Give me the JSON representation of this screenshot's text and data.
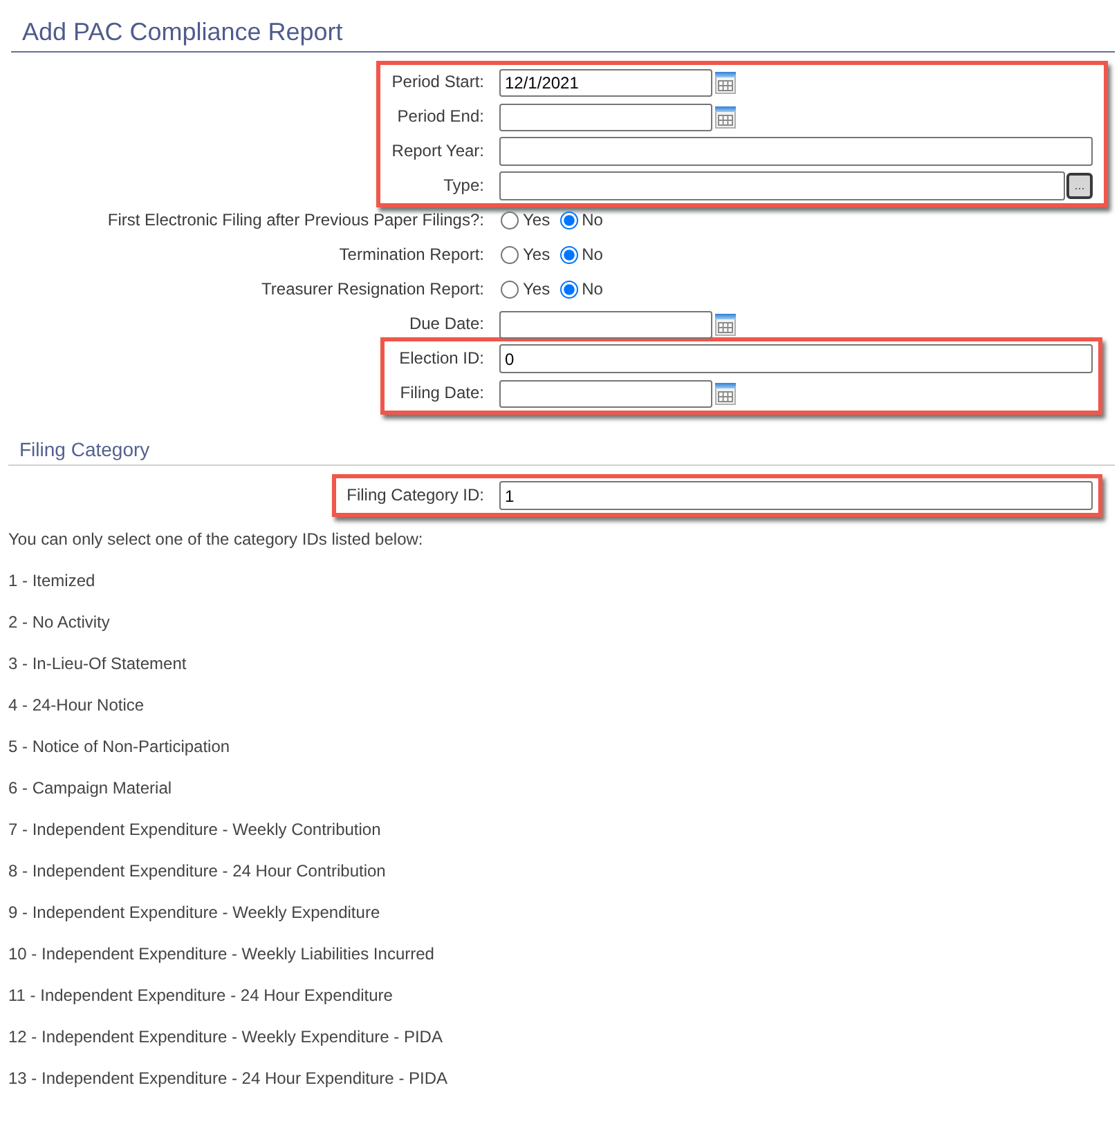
{
  "title": "Add PAC Compliance Report",
  "report_form": [
    {
      "highlighted": true,
      "rows": [
        {
          "kind": "date",
          "label": "Period Start:",
          "value": "12/1/2021"
        },
        {
          "kind": "date",
          "label": "Period End:"
        },
        {
          "kind": "text",
          "label": "Report Year:"
        },
        {
          "kind": "lookup",
          "label": "Type:",
          "button": "..."
        }
      ]
    },
    {
      "highlighted": false,
      "rows": [
        {
          "kind": "radio",
          "label": "First Electronic Filing after Previous Paper Filings?:",
          "options": [
            {
              "label": "Yes",
              "selected": false
            },
            {
              "label": "No",
              "selected": true
            }
          ]
        },
        {
          "kind": "radio",
          "label": "Termination Report:",
          "options": [
            {
              "label": "Yes",
              "selected": false
            },
            {
              "label": "No",
              "selected": true
            }
          ]
        },
        {
          "kind": "radio",
          "label": "Treasurer Resignation Report:",
          "options": [
            {
              "label": "Yes",
              "selected": false
            },
            {
              "label": "No",
              "selected": true
            }
          ]
        },
        {
          "kind": "date",
          "label": "Due Date:"
        }
      ]
    },
    {
      "highlighted": true,
      "rows": [
        {
          "kind": "text",
          "label": "Election ID:",
          "value": "0"
        },
        {
          "kind": "date",
          "label": "Filing Date:"
        }
      ]
    }
  ],
  "filing_category": {
    "heading": "Filing Category",
    "form": [
      {
        "highlighted": true,
        "rows": [
          {
            "kind": "text",
            "label": "Filing Category ID:",
            "value": "1"
          }
        ]
      }
    ],
    "instruction": "You can only select one of the category IDs listed below:",
    "categories": [
      "1 - Itemized",
      "2 - No Activity",
      "3 - In-Lieu-Of Statement",
      "4 - 24-Hour Notice",
      "5 - Notice of Non-Participation",
      "6 - Campaign Material",
      "7 - Independent Expenditure - Weekly Contribution",
      "8 - Independent Expenditure - 24 Hour Contribution",
      "9 - Independent Expenditure - Weekly Expenditure",
      "10 - Independent Expenditure - Weekly Liabilities Incurred",
      "11 - Independent Expenditure - 24 Hour Expenditure",
      "12 - Independent Expenditure - Weekly Expenditure - PIDA",
      "13 - Independent Expenditure - 24 Hour Expenditure - PIDA"
    ]
  }
}
